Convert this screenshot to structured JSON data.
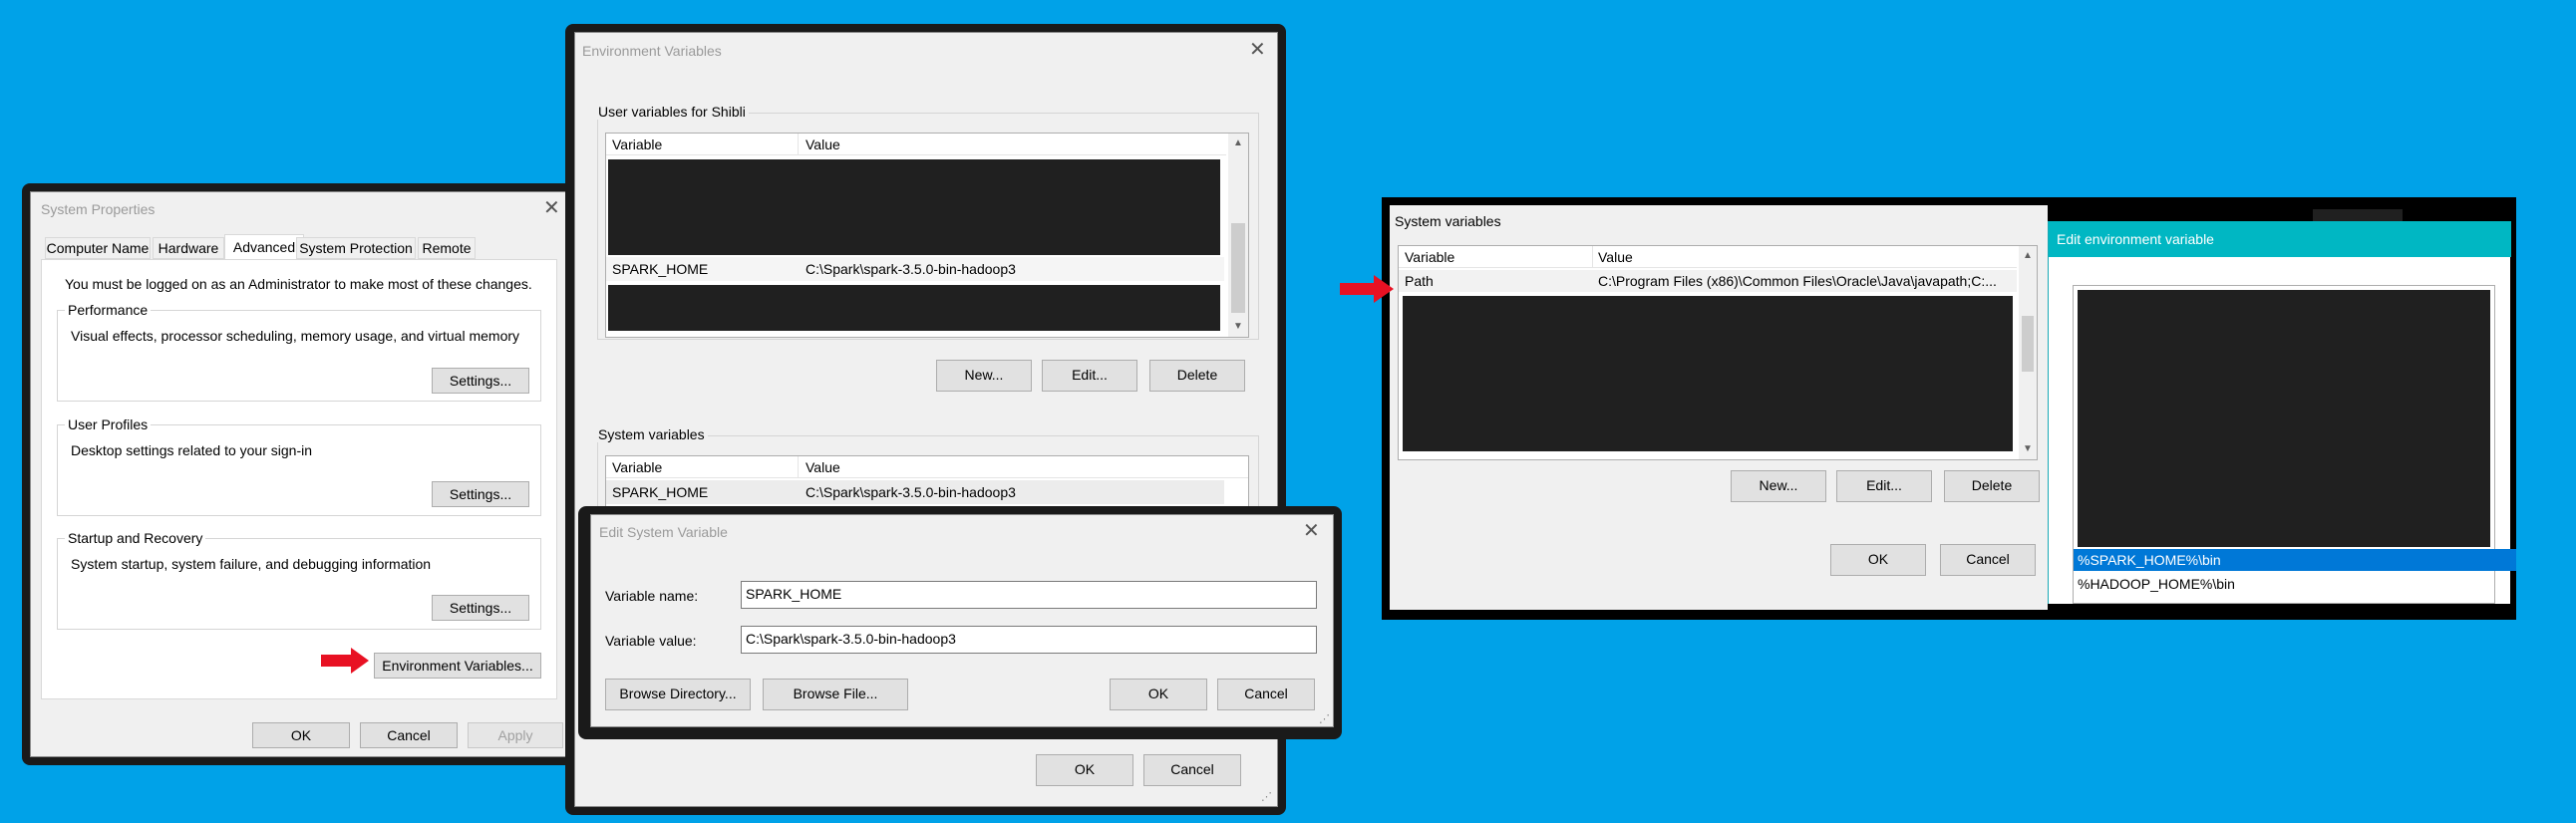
{
  "system_properties": {
    "title": "System Properties",
    "tabs": [
      "Computer Name",
      "Hardware",
      "Advanced",
      "System Protection",
      "Remote"
    ],
    "admin_note": "You must be logged on as an Administrator to make most of these changes.",
    "performance": {
      "label": "Performance",
      "desc": "Visual effects, processor scheduling, memory usage, and virtual memory",
      "settings": "Settings..."
    },
    "user_profiles": {
      "label": "User Profiles",
      "desc": "Desktop settings related to your sign-in",
      "settings": "Settings..."
    },
    "startup": {
      "label": "Startup and Recovery",
      "desc": "System startup, system failure, and debugging information",
      "settings": "Settings..."
    },
    "env_button": "Environment Variables...",
    "ok": "OK",
    "cancel": "Cancel",
    "apply": "Apply"
  },
  "env_vars": {
    "title": "Environment Variables",
    "user_group": "User variables for Shibli",
    "col_variable": "Variable",
    "col_value": "Value",
    "user_row": {
      "variable": "SPARK_HOME",
      "value": "C:\\Spark\\spark-3.5.0-bin-hadoop3"
    },
    "new": "New...",
    "edit": "Edit...",
    "delete": "Delete",
    "system_group": "System variables",
    "system_row": {
      "variable": "SPARK_HOME",
      "value": "C:\\Spark\\spark-3.5.0-bin-hadoop3"
    },
    "ok": "OK",
    "cancel": "Cancel"
  },
  "edit_system_variable": {
    "title": "Edit System Variable",
    "name_label": "Variable name:",
    "name_value": "SPARK_HOME",
    "value_label": "Variable value:",
    "value_value": "C:\\Spark\\spark-3.5.0-bin-hadoop3",
    "browse_dir": "Browse Directory...",
    "browse_file": "Browse File...",
    "ok": "OK",
    "cancel": "Cancel"
  },
  "right_panel": {
    "system_vars_label": "System variables",
    "col_variable": "Variable",
    "col_value": "Value",
    "path_row": {
      "variable": "Path",
      "value": "C:\\Program Files (x86)\\Common Files\\Oracle\\Java\\javapath;C:..."
    },
    "new": "New...",
    "edit": "Edit...",
    "delete": "Delete",
    "ok": "OK",
    "cancel": "Cancel"
  },
  "edit_env_variable": {
    "title": "Edit environment variable",
    "entries": [
      "%SPARK_HOME%\\bin",
      "%HADOOP_HOME%\\bin"
    ]
  },
  "colors": {
    "desktop": "#00a2e8",
    "selection": "#0078d7",
    "arrow": "#e81123",
    "redaction": "#202020"
  }
}
